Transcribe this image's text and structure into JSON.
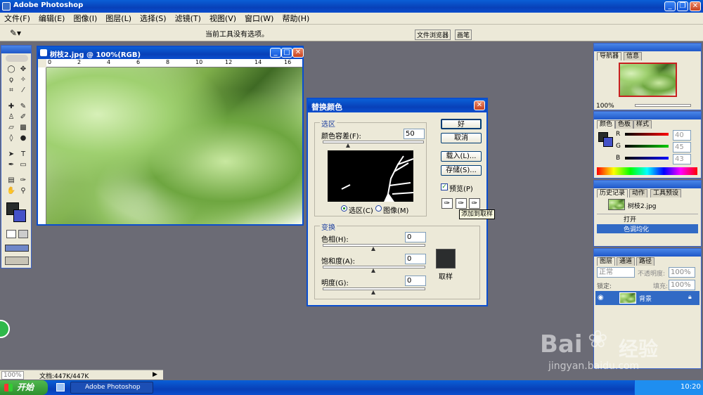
{
  "app": {
    "title": "Adobe Photoshop",
    "icon": "photoshop-icon"
  },
  "menu": [
    "文件(F)",
    "编辑(E)",
    "图像(I)",
    "图层(L)",
    "选择(S)",
    "滤镜(T)",
    "视图(V)",
    "窗口(W)",
    "帮助(H)"
  ],
  "options": {
    "hint": "当前工具没有选项。",
    "tab_browser": "文件浏览器",
    "tab_brushes": "画笔"
  },
  "doc": {
    "title": "树枝2.jpg @ 100%(RGB)",
    "ruler": [
      "0",
      "2",
      "4",
      "6",
      "8",
      "10",
      "12",
      "14",
      "16"
    ]
  },
  "dialog": {
    "title": "替换颜色",
    "selection_group": "选区",
    "tolerance_label": "颜色容差(F):",
    "tolerance_value": "50",
    "radio_selection": "选区(C)",
    "radio_image": "图像(M)",
    "ok": "好",
    "cancel": "取消",
    "load": "载入(L)...",
    "save": "存储(S)...",
    "preview_label": "预览(P)",
    "tooltip": "添加到取样",
    "transform_group": "变换",
    "hue_label": "色相(H):",
    "hue_value": "0",
    "sat_label": "饱和度(A):",
    "sat_value": "0",
    "light_label": "明度(G):",
    "light_value": "0",
    "sample_label": "取样",
    "sample_color": "#2b2d2e"
  },
  "navigator": {
    "tabs": [
      "导航器",
      "信息"
    ],
    "zoom": "100%"
  },
  "color": {
    "tabs": [
      "颜色",
      "色板",
      "样式"
    ],
    "r_label": "R",
    "r": "40",
    "g_label": "G",
    "g": "45",
    "b_label": "B",
    "b": "43"
  },
  "history": {
    "tabs": [
      "历史记录",
      "动作",
      "工具预设"
    ],
    "snapshot": "树枝2.jpg",
    "items": [
      "打开",
      "色调均化"
    ]
  },
  "layers": {
    "tabs": [
      "图层",
      "通道",
      "路径"
    ],
    "mode": "正常",
    "opacity_label": "不透明度:",
    "opacity": "100%",
    "lock_label": "锁定:",
    "fill_label": "填充:",
    "fill": "100%",
    "layer_name": "背景"
  },
  "status": {
    "zoom": "100%",
    "doc": "文档:447K/447K"
  },
  "taskbar": {
    "start": "开始",
    "task": "Adobe Photoshop",
    "clock": "10:20"
  },
  "watermark": {
    "brand": "Bai",
    "brand2": "经验",
    "url": "jingyan.baidu.com"
  },
  "colors": {
    "accent": "#0a4ecf",
    "panel": "#ece9d8",
    "canvas": "#6b6b75"
  }
}
